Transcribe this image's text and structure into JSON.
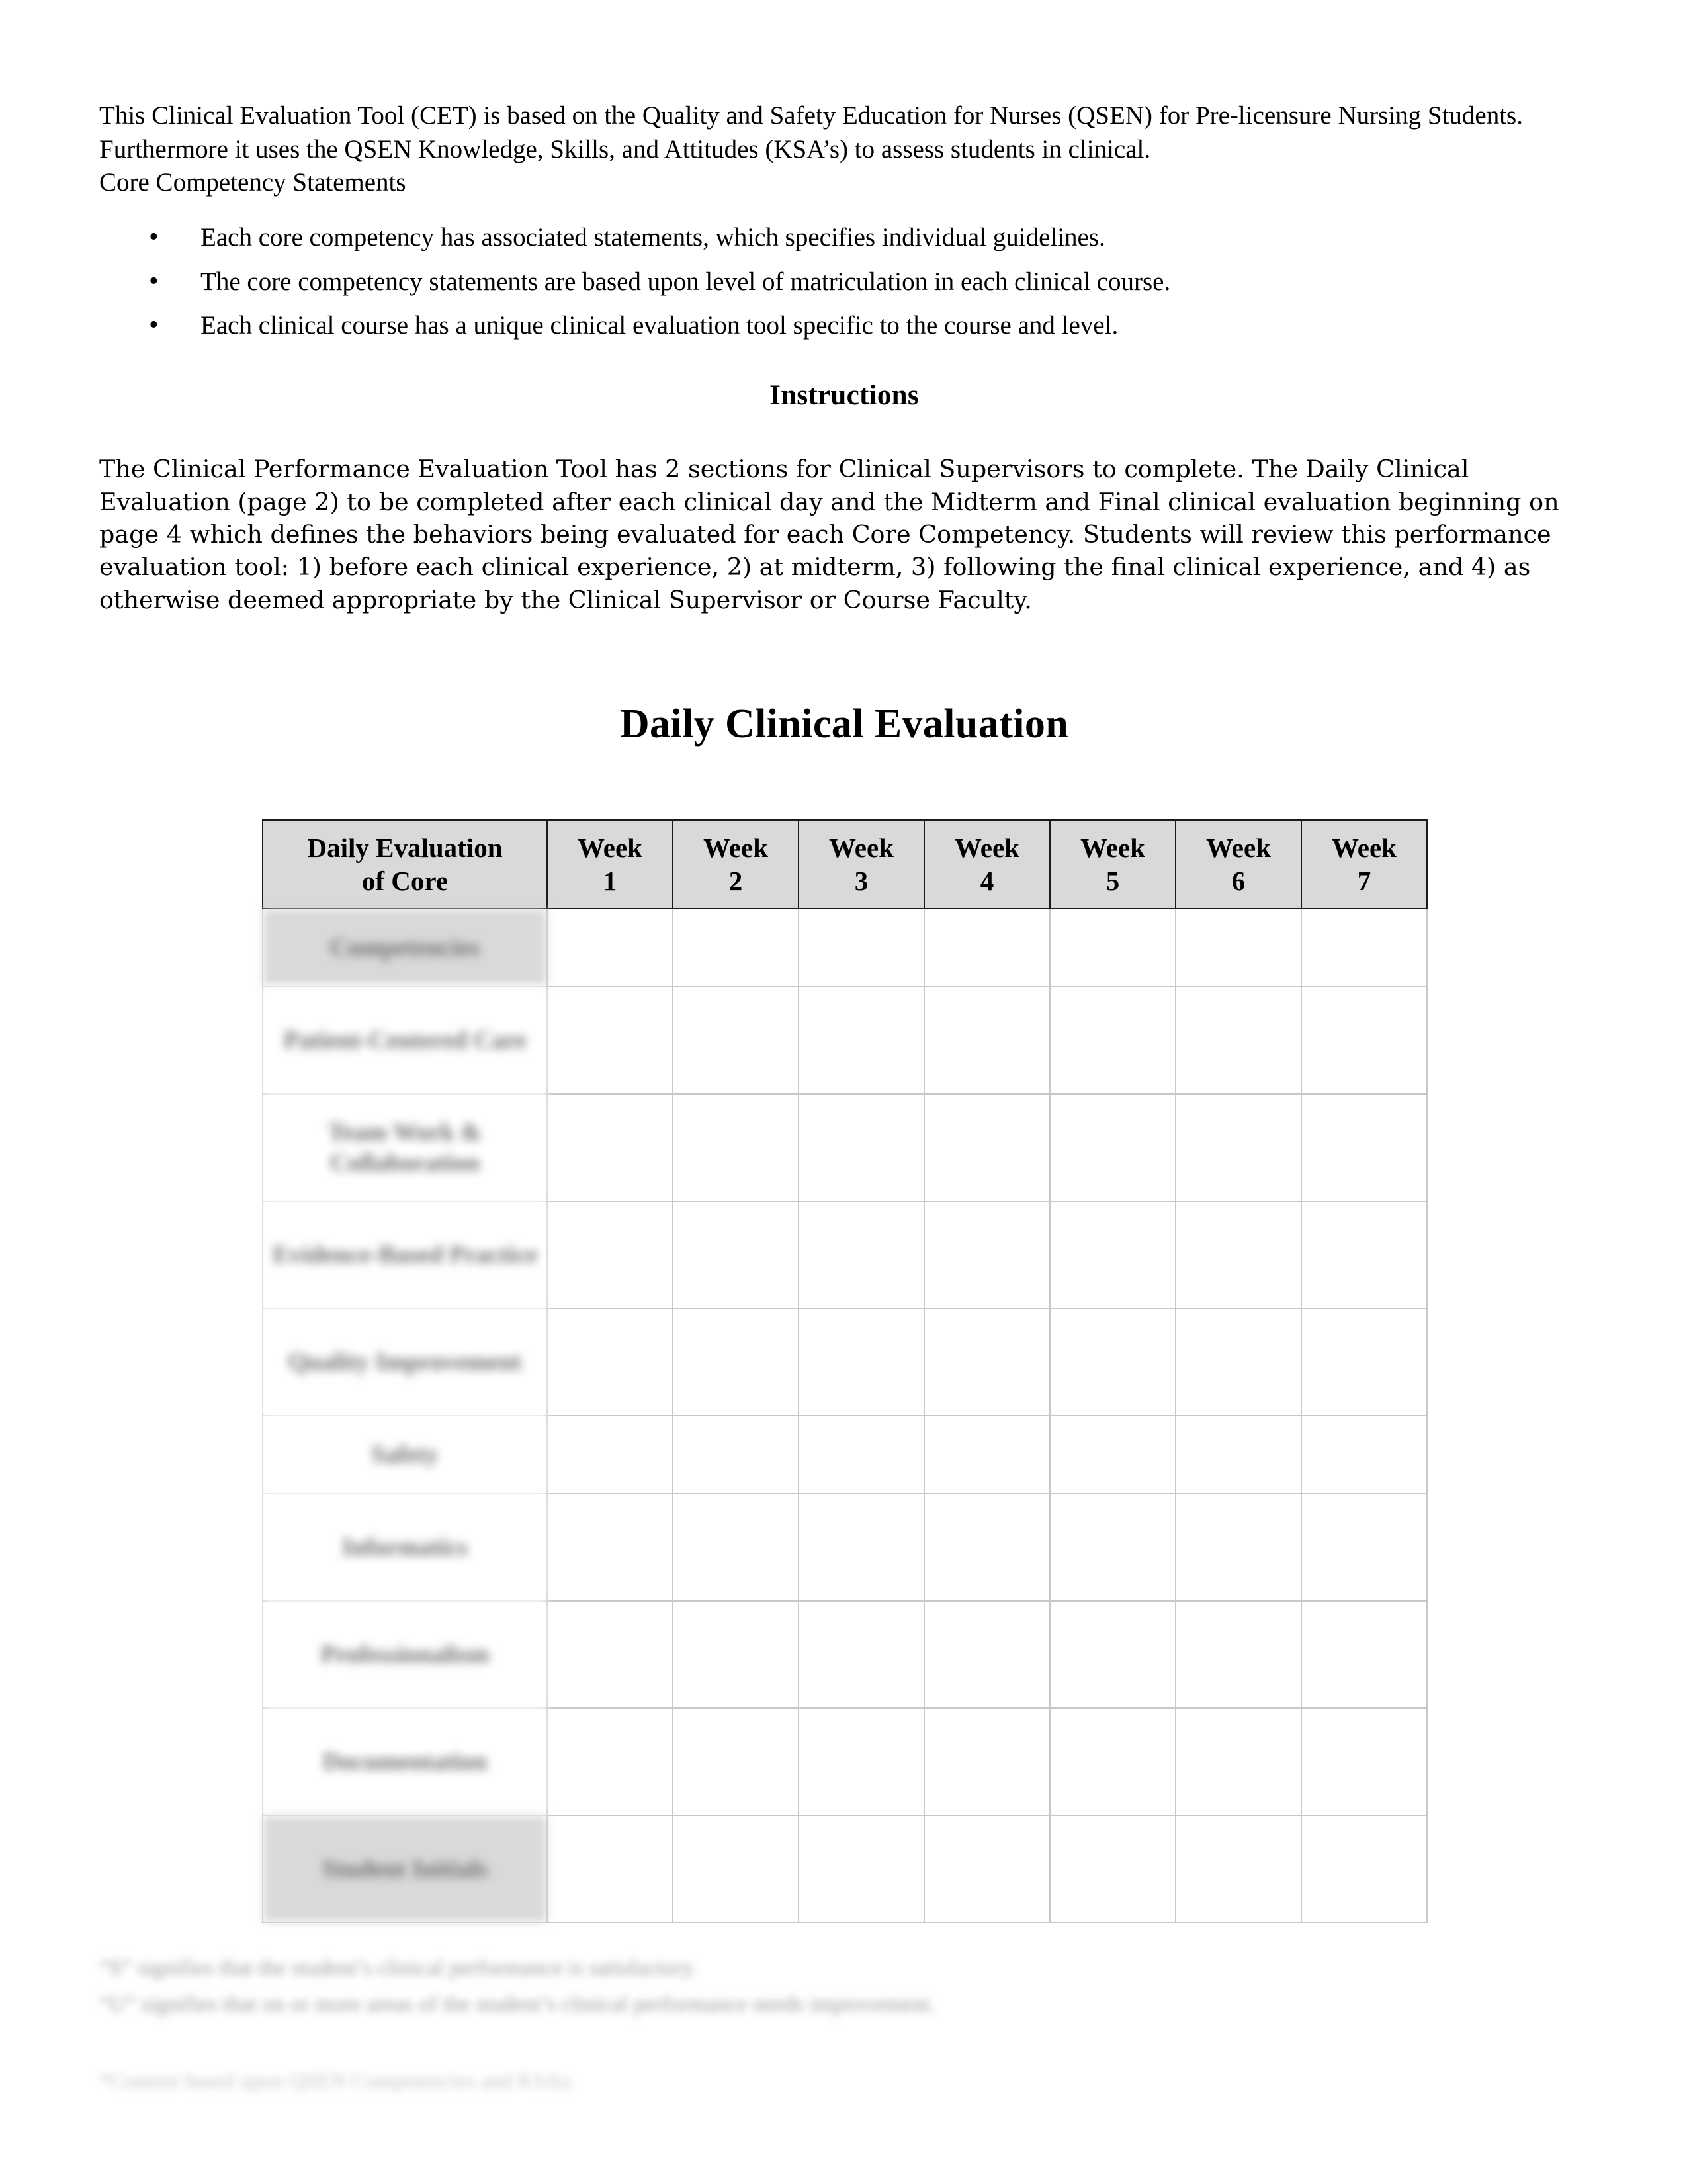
{
  "document": {
    "intro_paragraph": "This Clinical Evaluation Tool (CET) is based on the Quality and Safety Education for Nurses (QSEN) for Pre-licensure Nursing Students. Furthermore it uses the QSEN Knowledge, Skills, and Attitudes (KSA’s) to assess students in clinical.",
    "core_competency_label": "Core Competency Statements",
    "bullets": [
      "Each core competency has associated statements, which specifies individual guidelines.",
      "The core competency statements are based upon level of matriculation in each clinical course.",
      "Each clinical course has a unique clinical evaluation tool specific to the course and level."
    ],
    "instructions_heading": "Instructions",
    "instructions_paragraph": "The Clinical Performance Evaluation Tool has 2 sections for Clinical Supervisors to complete.  The Daily Clinical Evaluation (page 2) to be completed after each clinical day and the Midterm and Final clinical evaluation beginning on page 4 which defines the behaviors being evaluated for each Core Competency. Students will review this performance evaluation tool: 1) before each clinical experience, 2) at midterm, 3) following the final clinical experience, and 4) as otherwise deemed appropriate by the Clinical Supervisor or Course Faculty.",
    "main_title": "Daily Clinical Evaluation"
  },
  "table": {
    "row_header_label_line1": "Daily Evaluation",
    "row_header_label_line2": "of Core",
    "week_label": "Week",
    "week_numbers": [
      "1",
      "2",
      "3",
      "4",
      "5",
      "6",
      "7"
    ],
    "rows": [
      {
        "label": "Competencies",
        "shaded": true,
        "size": "normal"
      },
      {
        "label": "Patient-Centered Care",
        "shaded": false,
        "size": "tall"
      },
      {
        "label": "Team Work & Collaboration",
        "shaded": false,
        "size": "tall"
      },
      {
        "label": "Evidence-Based Practice",
        "shaded": false,
        "size": "tall"
      },
      {
        "label": "Quality Improvement",
        "shaded": false,
        "size": "tall"
      },
      {
        "label": "Safety",
        "shaded": false,
        "size": "normal"
      },
      {
        "label": "Informatics",
        "shaded": false,
        "size": "tall"
      },
      {
        "label": "Professionalism",
        "shaded": false,
        "size": "tall"
      },
      {
        "label": "Documentation",
        "shaded": false,
        "size": "tall"
      },
      {
        "label": "Student Initials",
        "shaded": true,
        "size": "tall"
      }
    ],
    "header_fill": "#d9d9d9",
    "shaded_fill": "#d9d9d9"
  },
  "footnotes": {
    "line1": "“S” signifies that the student’s clinical performance is satisfactory.",
    "line2": "“U” signifies that on or more areas of the student’s clinical performance needs improvement.",
    "source": "*Content based upon QSEN Competencies and KSAs."
  }
}
